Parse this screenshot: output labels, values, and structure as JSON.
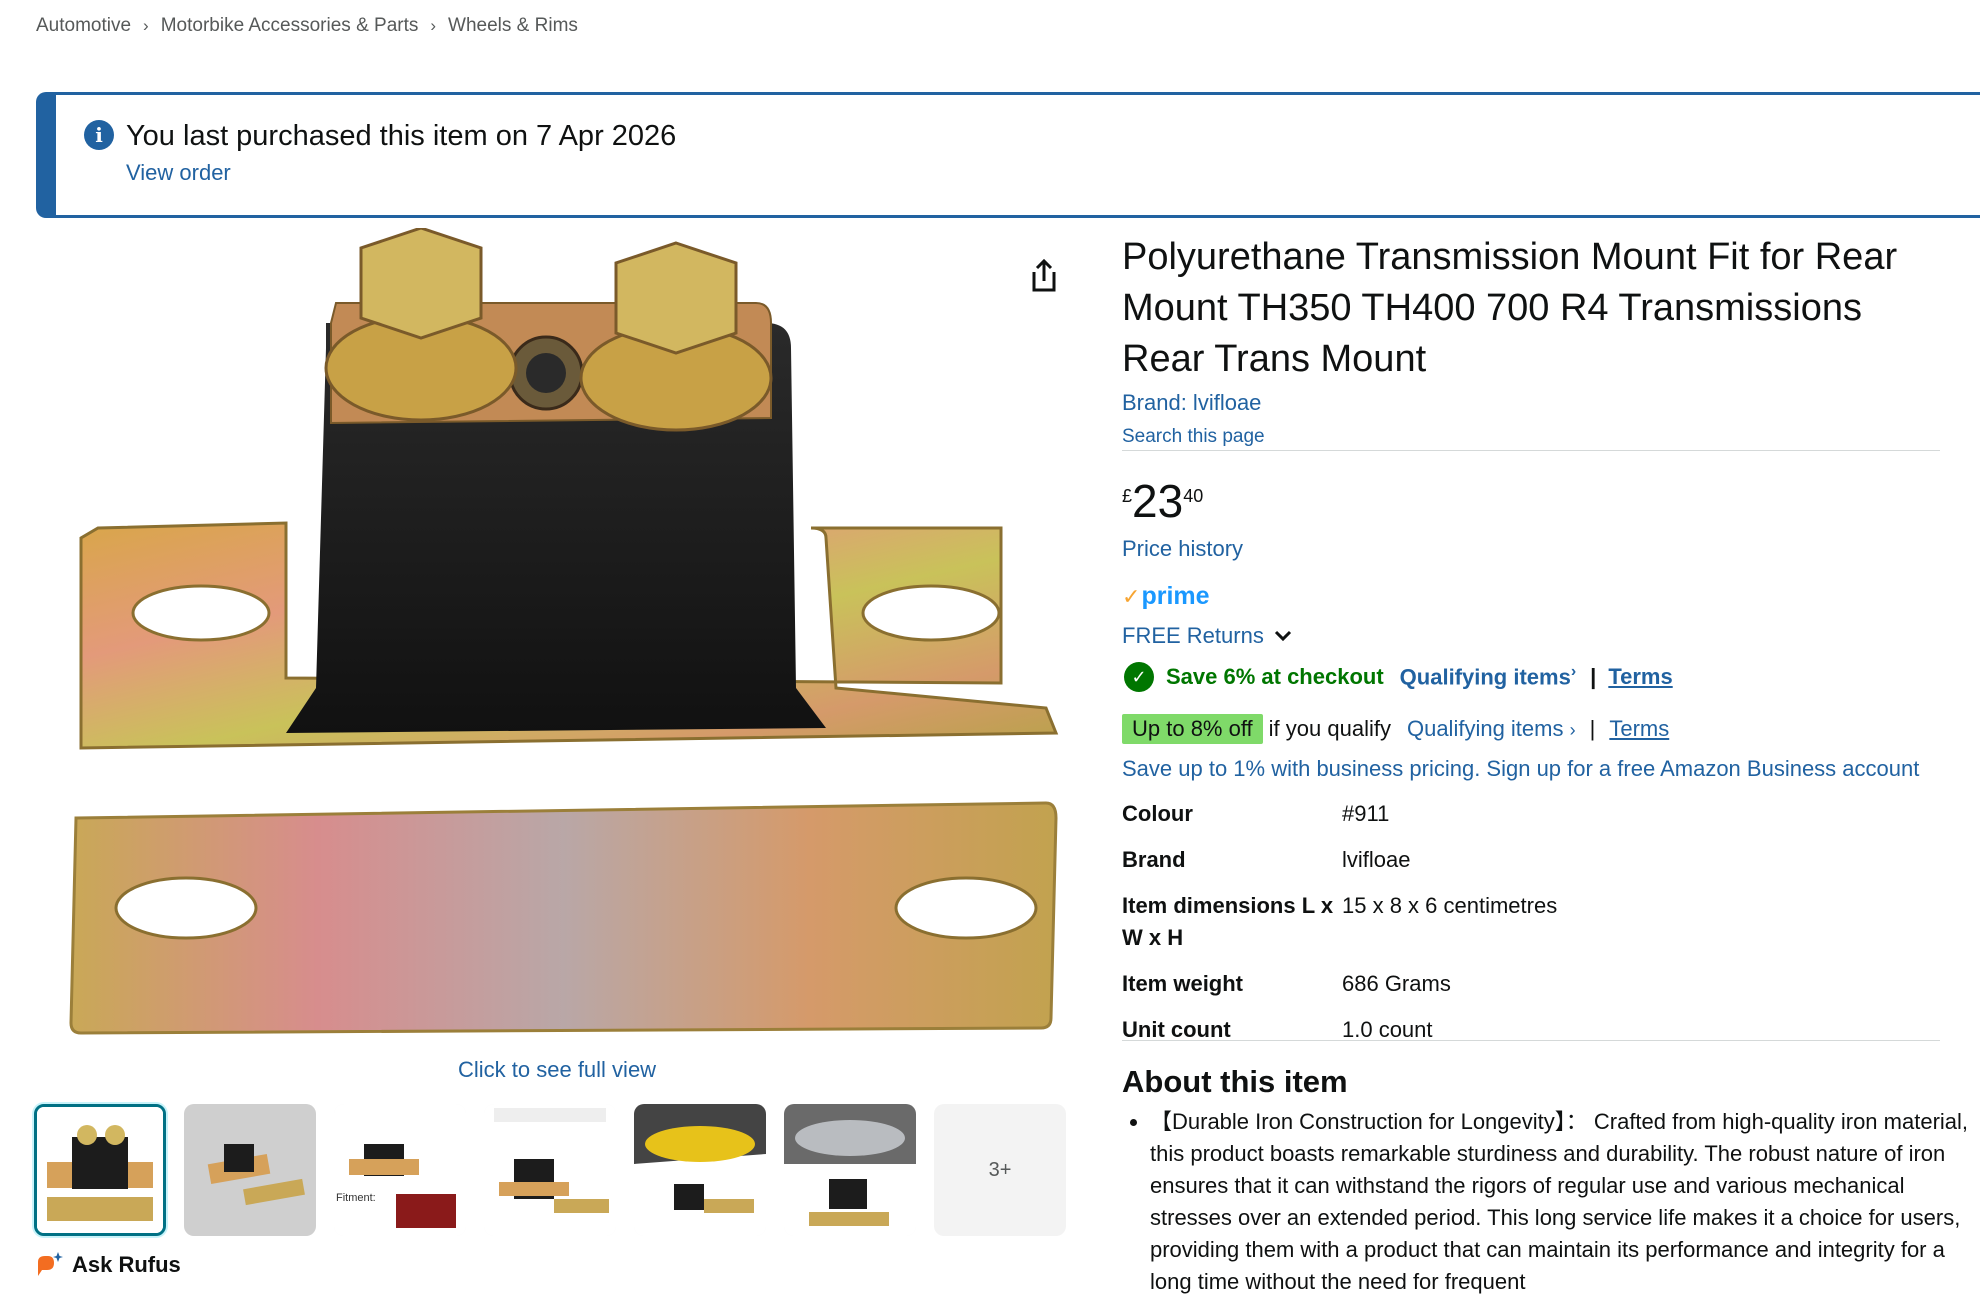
{
  "breadcrumb": [
    "Automotive",
    "Motorbike Accessories & Parts",
    "Wheels & Rims"
  ],
  "alert": {
    "message": "You last purchased this item on 7 Apr 2026",
    "link": "View order"
  },
  "gallery": {
    "full_view": "Click to see full view",
    "more_label": "3+",
    "thumb_fitment": "Fitment:",
    "rufus": "Ask Rufus"
  },
  "product": {
    "title": "Polyurethane Transmission Mount Fit for Rear Mount TH350 TH400 700 R4 Transmissions Rear Trans Mount",
    "brand_link": "Brand: lvifloae",
    "search_page": "Search this page",
    "price_currency": "£",
    "price_whole": "23",
    "price_fraction": "40",
    "price_history": "Price history",
    "prime": "prime",
    "returns": "FREE Returns",
    "save_text": "Save 6% at checkout",
    "qualifying_items": "Qualifying items",
    "terms": "Terms",
    "off_badge": "Up to 8% off",
    "off_text": "if you qualify",
    "business": "Save up to 1% with business pricing. Sign up for a free Amazon Business account"
  },
  "specs": [
    {
      "key": "Colour",
      "value": "#911"
    },
    {
      "key": "Brand",
      "value": "lvifloae"
    },
    {
      "key": "Item dimensions L x W x H",
      "value": "15 x 8 x 6 centimetres"
    },
    {
      "key": "Item weight",
      "value": "686 Grams"
    },
    {
      "key": "Unit count",
      "value": "1.0 count"
    }
  ],
  "about": {
    "heading": "About this item",
    "bullets": [
      "【Durable Iron Construction for Longevity】： Crafted from high-quality iron material, this product boasts remarkable sturdiness and durability. The robust nature of iron ensures that it can withstand the rigors of regular use and various mechanical stresses over an extended period. This long service life makes it a choice for users, providing them with a product that can maintain its performance and integrity for a long time without the need for frequent"
    ]
  },
  "colors": {
    "link": "#2162a1",
    "alert_border": "#2162a1",
    "save_green": "#007600",
    "badge_green": "#7fda69",
    "prime_blue": "#1a98ff"
  }
}
